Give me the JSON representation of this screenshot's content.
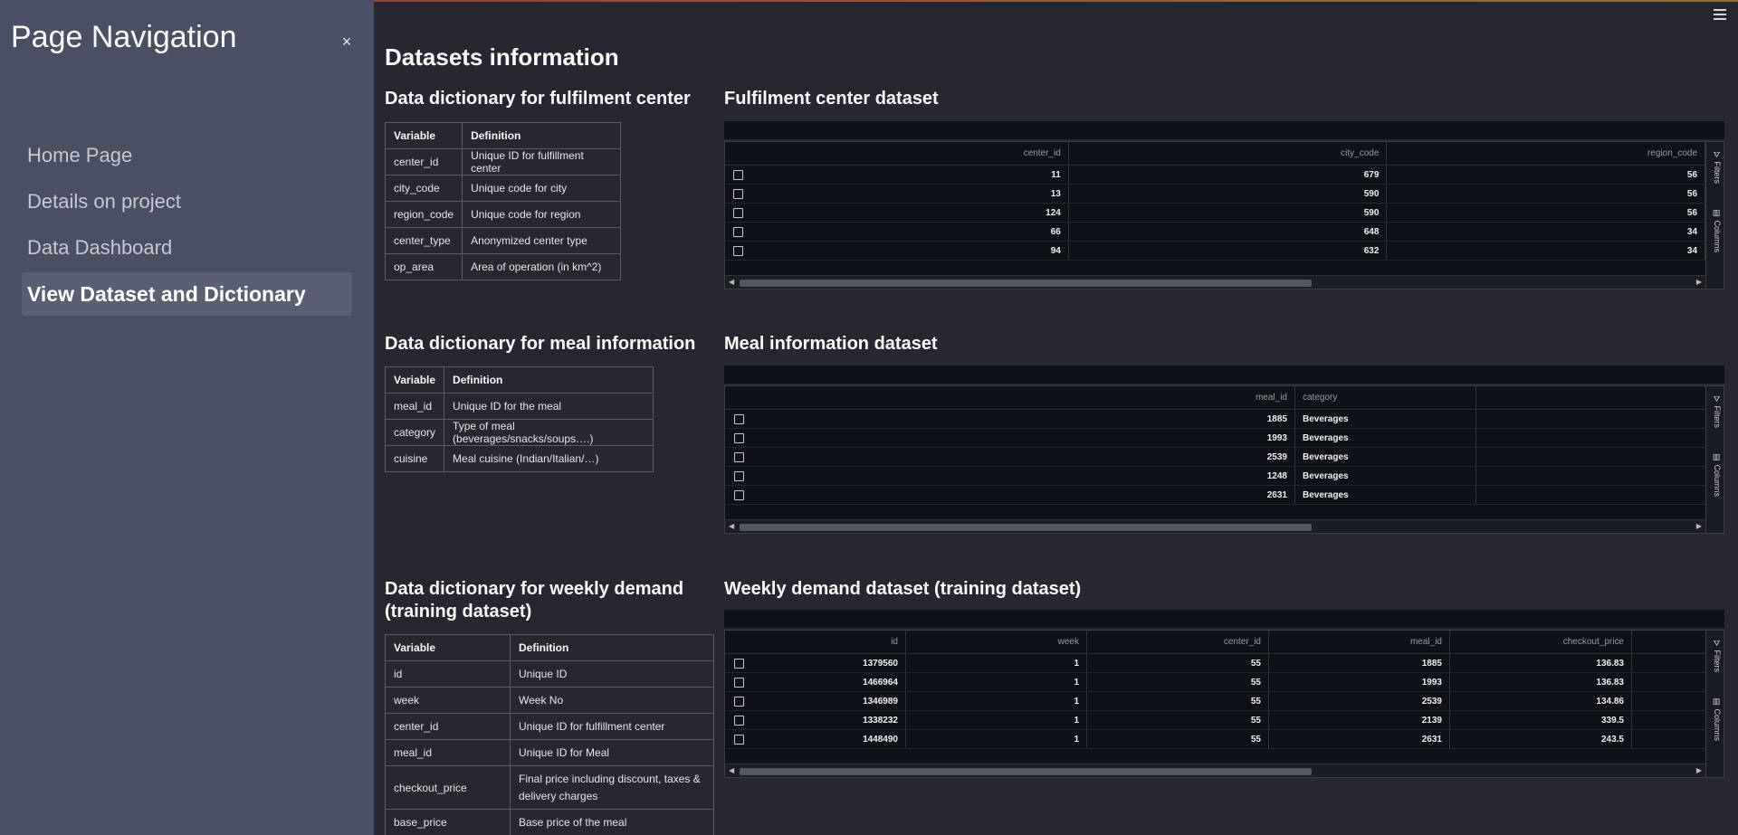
{
  "sidebar": {
    "title": "Page Navigation",
    "close_glyph": "×",
    "items": [
      {
        "label": "Home Page"
      },
      {
        "label": "Details on project"
      },
      {
        "label": "Data Dashboard"
      },
      {
        "label": "View Dataset and Dictionary"
      }
    ]
  },
  "main": {
    "title": "Datasets information",
    "dict_fulfil_title": "Data dictionary for fulfilment center",
    "dict_meal_title": "Data dictionary for meal information",
    "dict_weekly_title": "Data dictionary for weekly demand (training dataset)",
    "df_fulfil_title": "Fulfilment center dataset",
    "df_meal_title": "Meal information dataset",
    "df_weekly_title": "Weekly demand dataset (training dataset)"
  },
  "dict_headers": {
    "variable": "Variable",
    "definition": "Definition"
  },
  "dict_fulfil": [
    [
      "center_id",
      "Unique ID for fulfillment center"
    ],
    [
      "city_code",
      "Unique code for city"
    ],
    [
      "region_code",
      "Unique code for region"
    ],
    [
      "center_type",
      "Anonymized center type"
    ],
    [
      "op_area",
      "Area of operation (in km^2)"
    ]
  ],
  "dict_meal": [
    [
      "meal_id",
      "Unique ID for the meal"
    ],
    [
      "category",
      "Type of meal (beverages/snacks/soups….)"
    ],
    [
      "cuisine",
      "Meal cuisine (Indian/Italian/…)"
    ]
  ],
  "dict_weekly": [
    [
      "id",
      "Unique ID"
    ],
    [
      "week",
      "Week No"
    ],
    [
      "center_id",
      "Unique ID for fulfillment center"
    ],
    [
      "meal_id",
      "Unique ID for Meal"
    ],
    [
      "checkout_price",
      "Final price including discount, taxes & delivery charges"
    ],
    [
      "base_price",
      "Base price of the meal"
    ]
  ],
  "df_labels": {
    "filters": "Filters",
    "columns": "Columns",
    "filter_glyph": "⛛",
    "columns_glyph": "▥",
    "arrow_left": "◀",
    "arrow_right": "▶"
  },
  "df_fulfil": {
    "columns": [
      "center_id",
      "city_code",
      "region_code"
    ],
    "rows": [
      [
        "11",
        "679",
        "56"
      ],
      [
        "13",
        "590",
        "56"
      ],
      [
        "124",
        "590",
        "56"
      ],
      [
        "66",
        "648",
        "34"
      ],
      [
        "94",
        "632",
        "34"
      ]
    ]
  },
  "df_meal": {
    "columns": [
      "meal_id",
      "category"
    ],
    "rows": [
      [
        "1885",
        "Beverages"
      ],
      [
        "1993",
        "Beverages"
      ],
      [
        "2539",
        "Beverages"
      ],
      [
        "1248",
        "Beverages"
      ],
      [
        "2631",
        "Beverages"
      ]
    ]
  },
  "df_weekly": {
    "columns": [
      "id",
      "week",
      "center_id",
      "meal_id",
      "checkout_price"
    ],
    "rows": [
      [
        "1379560",
        "1",
        "55",
        "1885",
        "136.83"
      ],
      [
        "1466964",
        "1",
        "55",
        "1993",
        "136.83"
      ],
      [
        "1346989",
        "1",
        "55",
        "2539",
        "134.86"
      ],
      [
        "1338232",
        "1",
        "55",
        "2139",
        "339.5"
      ],
      [
        "1448490",
        "1",
        "55",
        "2631",
        "243.5"
      ]
    ]
  }
}
